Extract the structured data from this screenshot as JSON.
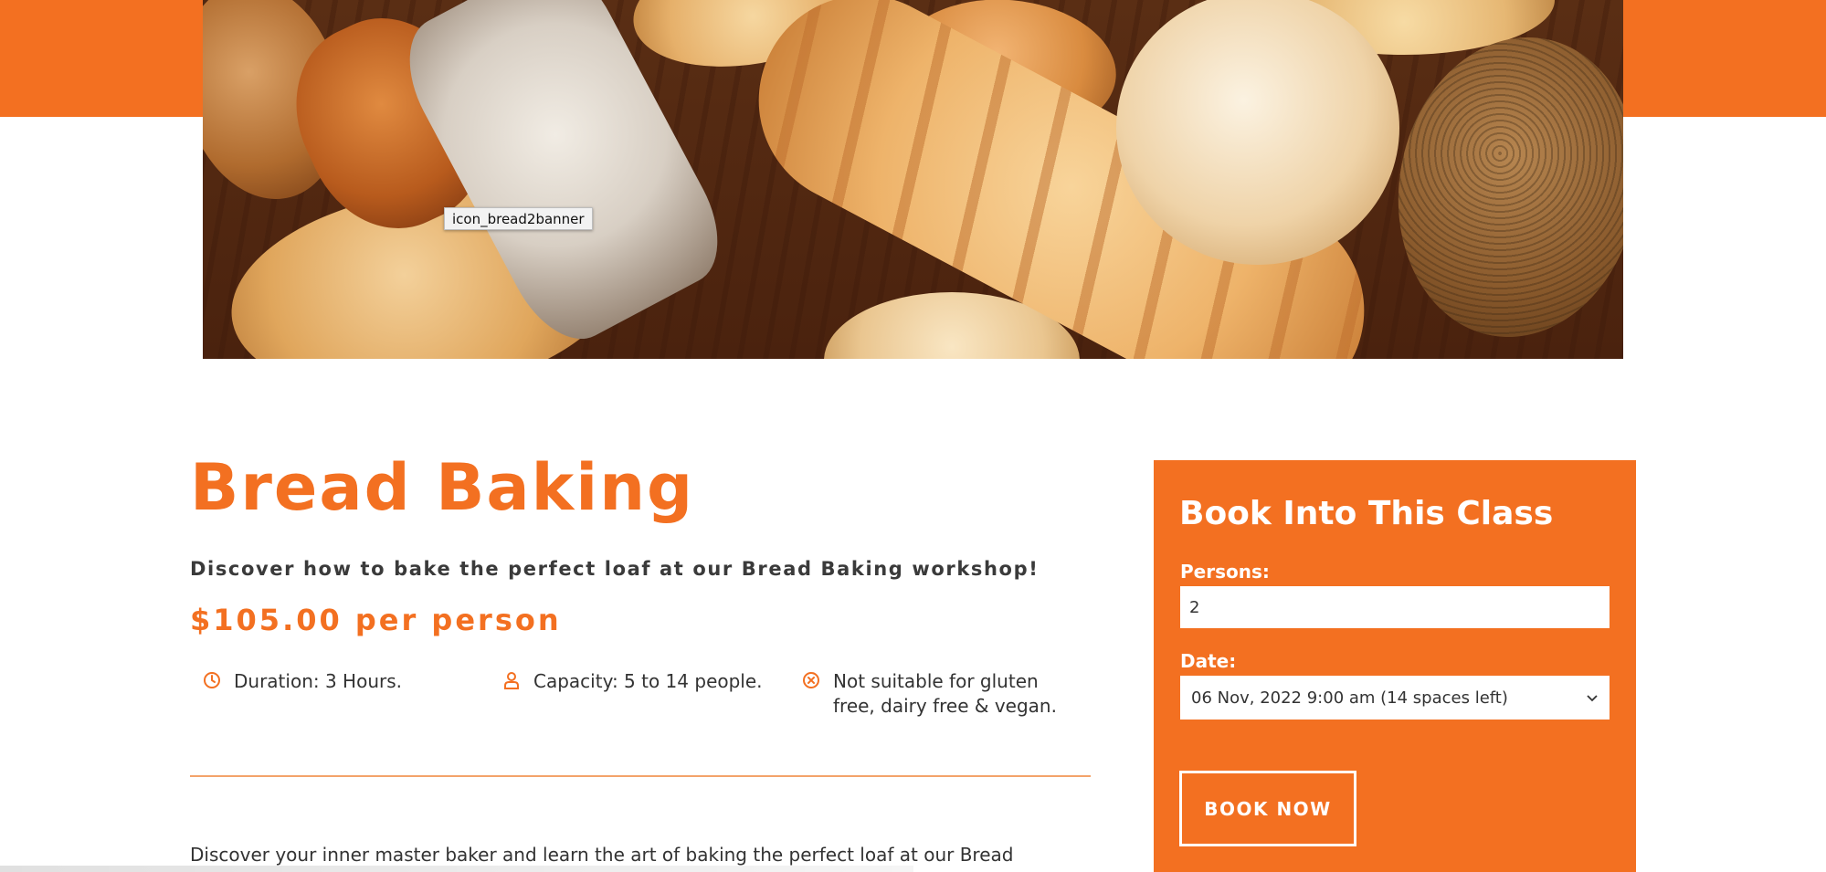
{
  "banner": {
    "tooltip": "icon_bread2banner"
  },
  "class": {
    "title": "Bread Baking",
    "subtitle": "Discover how to bake the perfect loaf at our Bread Baking workshop!",
    "price": "$105.00 per person",
    "features": [
      {
        "icon": "clock-icon",
        "text": "Duration: 3 Hours."
      },
      {
        "icon": "person-icon",
        "text": "Capacity: 5 to 14 people."
      },
      {
        "icon": "x-circle-icon",
        "text": "Not suitable for gluten free, dairy free & vegan."
      }
    ],
    "intro": "Discover your inner master baker and learn the art of baking the perfect loaf at our Bread"
  },
  "booking": {
    "title": "Book Into This Class",
    "persons_label": "Persons:",
    "persons_value": "2",
    "date_label": "Date:",
    "date_selected": "06 Nov, 2022 9:00 am (14 spaces left)",
    "book_button": "BOOK NOW"
  },
  "colors": {
    "accent": "#f37021",
    "text": "#333333",
    "white": "#ffffff"
  }
}
